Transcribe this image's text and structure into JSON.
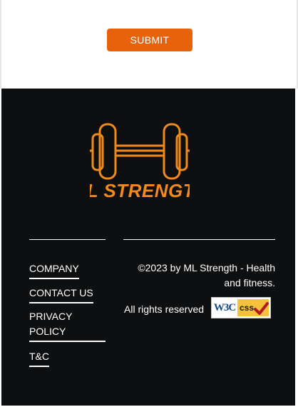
{
  "form": {
    "submit_label": "SUBMIT"
  },
  "footer": {
    "logo_text": "ML STRENGTH",
    "logo_icon": "dumbbell-icon",
    "nav": [
      {
        "label": "COMPANY"
      },
      {
        "label": "CONTACT US"
      },
      {
        "label": "PRIVACY POLICY"
      },
      {
        "label": "T&C"
      }
    ],
    "copyright": "©2023 by ML Strength - Health and fitness.",
    "rights": "All rights reserved",
    "badge": {
      "w3c": "W3C",
      "css": "css"
    }
  },
  "colors": {
    "accent": "#e8620c",
    "logo": "#f08a1c",
    "footer_bg": "#0e0f10"
  }
}
